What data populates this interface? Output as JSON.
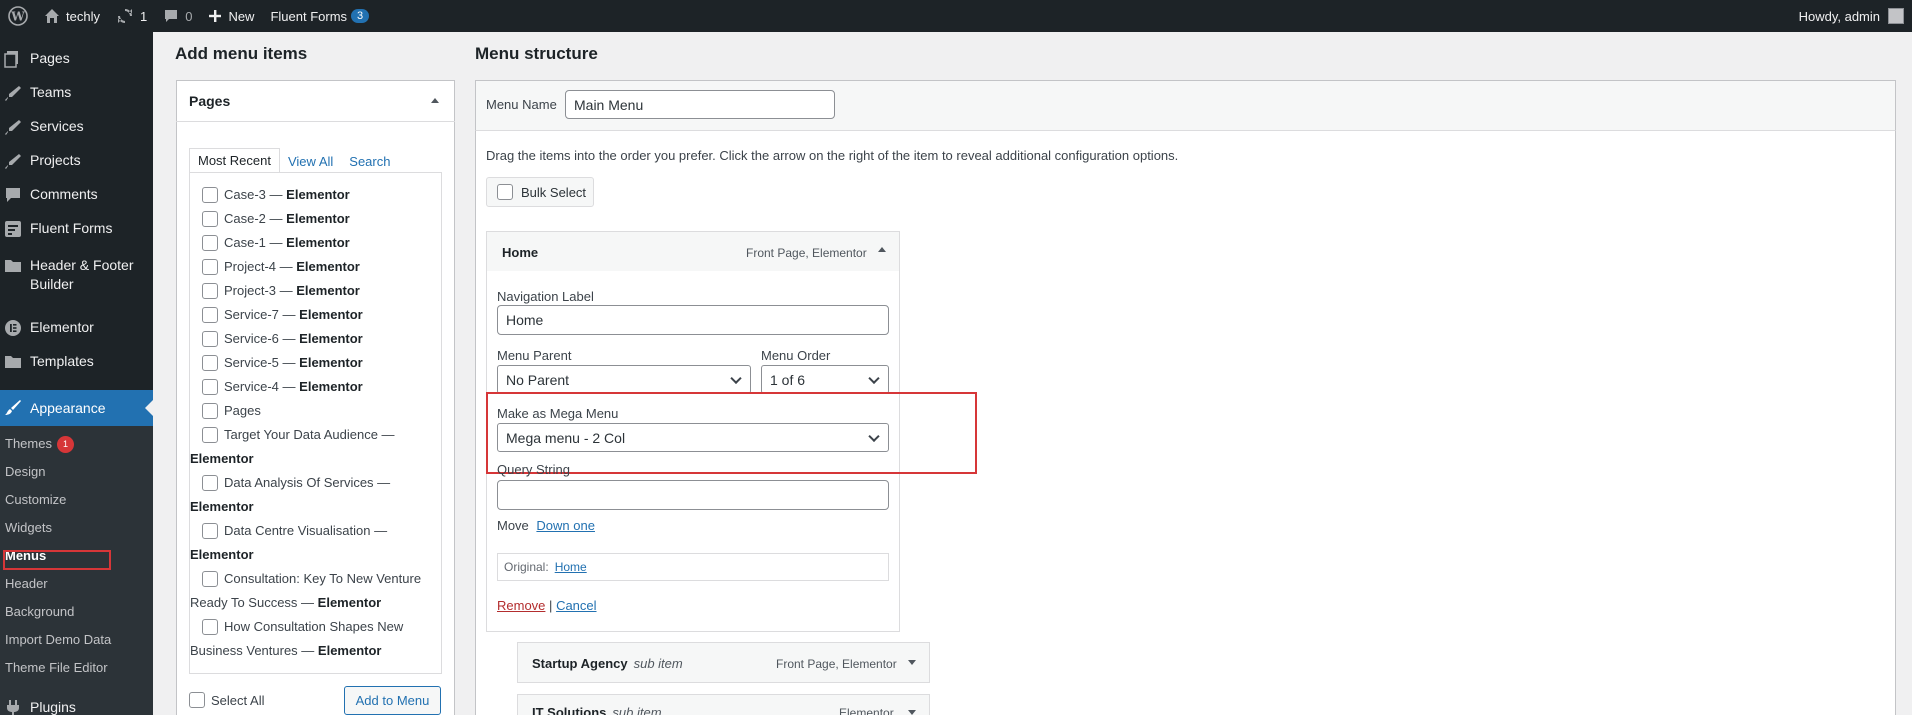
{
  "admin_bar": {
    "site_name": "techly",
    "updates_count": "1",
    "comments_count": "0",
    "new_label": "New",
    "fluent_forms_label": "Fluent Forms",
    "fluent_forms_count": "3",
    "howdy": "Howdy, admin"
  },
  "sidebar": {
    "items": [
      {
        "label": "Pages",
        "icon": "pages-icon"
      },
      {
        "label": "Teams",
        "icon": "pin-icon"
      },
      {
        "label": "Services",
        "icon": "pin-icon"
      },
      {
        "label": "Projects",
        "icon": "pin-icon"
      },
      {
        "label": "Comments",
        "icon": "comment-icon"
      },
      {
        "label": "Fluent Forms",
        "icon": "forms-icon"
      },
      {
        "label": "Header & Footer",
        "label2": "Builder",
        "icon": "folder-icon"
      },
      {
        "label": "Elementor",
        "icon": "elementor-icon"
      },
      {
        "label": "Templates",
        "icon": "folder-icon"
      },
      {
        "label": "Appearance",
        "icon": "brush-icon"
      },
      {
        "label": "Plugins",
        "icon": "plug-icon"
      }
    ],
    "submenu": [
      "Themes",
      "Design",
      "Customize",
      "Widgets",
      "Menus",
      "Header",
      "Background",
      "Import Demo Data",
      "Theme File Editor"
    ],
    "themes_badge": "1"
  },
  "add_items": {
    "heading": "Add menu items",
    "panel_title": "Pages",
    "tabs": [
      "Most Recent",
      "View All",
      "Search"
    ],
    "pages": [
      {
        "name": "Case-3",
        "suffix": "Elementor"
      },
      {
        "name": "Case-2",
        "suffix": "Elementor"
      },
      {
        "name": "Case-1",
        "suffix": "Elementor"
      },
      {
        "name": "Project-4",
        "suffix": "Elementor"
      },
      {
        "name": "Project-3",
        "suffix": "Elementor"
      },
      {
        "name": "Service-7",
        "suffix": "Elementor"
      },
      {
        "name": "Service-6",
        "suffix": "Elementor"
      },
      {
        "name": "Service-5",
        "suffix": "Elementor"
      },
      {
        "name": "Service-4",
        "suffix": "Elementor"
      },
      {
        "name": "Pages",
        "suffix": ""
      },
      {
        "name": "Target Your Data Audience —",
        "suffix": "Elementor",
        "wrap": true
      },
      {
        "name": "Data Analysis Of Services —",
        "suffix": "Elementor",
        "wrap": true
      },
      {
        "name": "Data Centre Visualisation —",
        "suffix": "Elementor",
        "wrap": true
      },
      {
        "name": "Consultation: Key To New Venture",
        "line2": "Ready To Success —",
        "suffix": "Elementor",
        "wrap2": true
      },
      {
        "name": "How Consultation Shapes New",
        "line2": "Business Ventures —",
        "suffix": "Elementor",
        "wrap2": true
      }
    ],
    "select_all": "Select All",
    "add_button": "Add to Menu"
  },
  "structure": {
    "heading": "Menu structure",
    "menu_name_label": "Menu Name",
    "menu_name_value": "Main Menu",
    "instructions": "Drag the items into the order you prefer. Click the arrow on the right of the item to reveal additional configuration options.",
    "bulk_select": "Bulk Select",
    "home_item": {
      "title": "Home",
      "type": "Front Page, Elementor",
      "nav_label_label": "Navigation Label",
      "nav_label_value": "Home",
      "menu_parent_label": "Menu Parent",
      "menu_parent_value": "No Parent",
      "menu_order_label": "Menu Order",
      "menu_order_value": "1 of 6",
      "mega_label": "Make as Mega Menu",
      "mega_value": "Mega menu - 2 Col",
      "query_label": "Query String",
      "query_value": "",
      "move_label": "Move",
      "move_link": "Down one",
      "original_label": "Original:",
      "original_link": "Home",
      "remove": "Remove",
      "sep": "|",
      "cancel": "Cancel"
    },
    "sub_items": [
      {
        "title": "Startup Agency",
        "sub": "sub item",
        "type": "Front Page, Elementor"
      },
      {
        "title": "IT Solutions",
        "sub": "sub item",
        "type": "Elementor"
      }
    ]
  }
}
